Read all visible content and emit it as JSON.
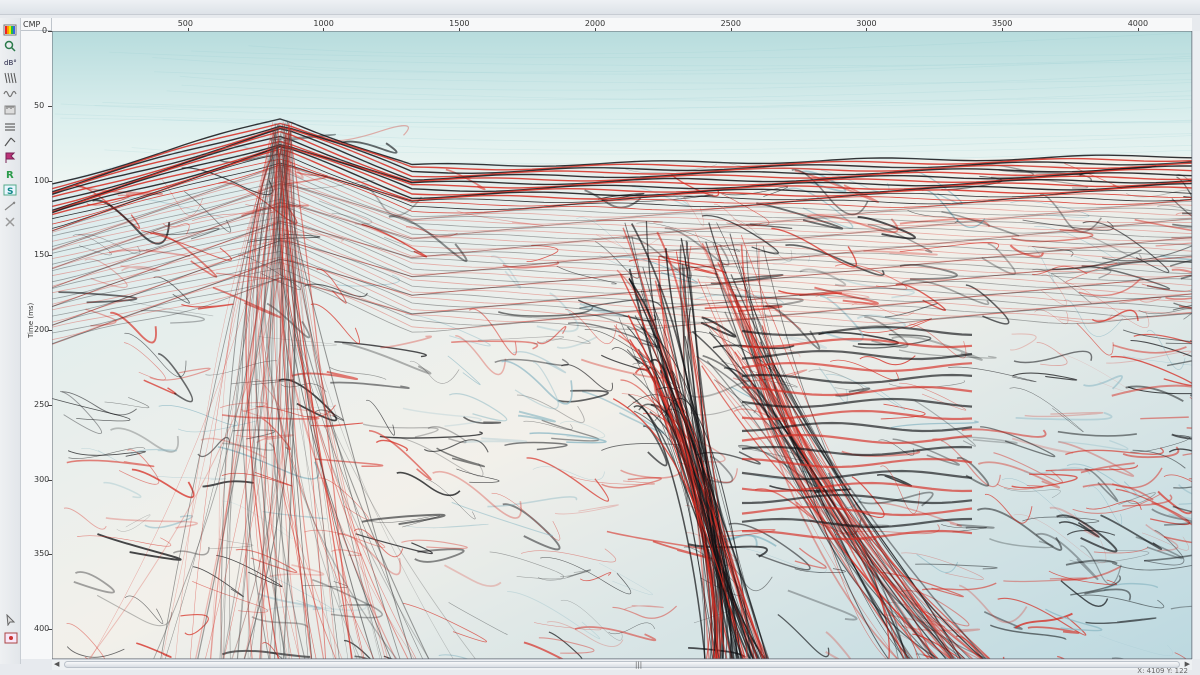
{
  "window": {
    "corner_label": "CMP",
    "axis_title": "Time (ms)",
    "status": "X: 4109 Y: 122"
  },
  "toolbar": {
    "icons": [
      "rainbow-palette-icon",
      "zoom-icon",
      "display-options-icon",
      "trace-icon",
      "wiggle-icon",
      "ruler-icon",
      "layers-icon",
      "pick-icon",
      "flag-icon",
      "r-button-icon",
      "s-button-icon",
      "line-icon",
      "cross-icon"
    ]
  },
  "axes": {
    "x_ticks": [
      {
        "label": "500",
        "value": 500
      },
      {
        "label": "1000",
        "value": 1000
      },
      {
        "label": "1500",
        "value": 1500
      },
      {
        "label": "2000",
        "value": 2000
      },
      {
        "label": "2500",
        "value": 2500
      },
      {
        "label": "3000",
        "value": 3000
      },
      {
        "label": "3500",
        "value": 3500
      },
      {
        "label": "4000",
        "value": 4000
      }
    ],
    "y_ticks": [
      {
        "label": "0",
        "value": 0
      },
      {
        "label": "50",
        "value": 50
      },
      {
        "label": "100",
        "value": 100
      },
      {
        "label": "150",
        "value": 150
      },
      {
        "label": "200",
        "value": 200
      },
      {
        "label": "250",
        "value": 250
      },
      {
        "label": "300",
        "value": 300
      },
      {
        "label": "350",
        "value": 350
      },
      {
        "label": "400",
        "value": 400
      }
    ],
    "x_min": 0,
    "x_max": 4200,
    "y_min": 0,
    "y_max": 420
  },
  "colors": {
    "red": "#d62a20",
    "black": "#101114",
    "cyan": "#c7e8ec",
    "blue": "#b6d5dc",
    "white": "#f7f5ef",
    "grid": "#444"
  },
  "scrollbar": {
    "left_arrow": "◀",
    "right_arrow": "▶",
    "grip": "|||"
  }
}
